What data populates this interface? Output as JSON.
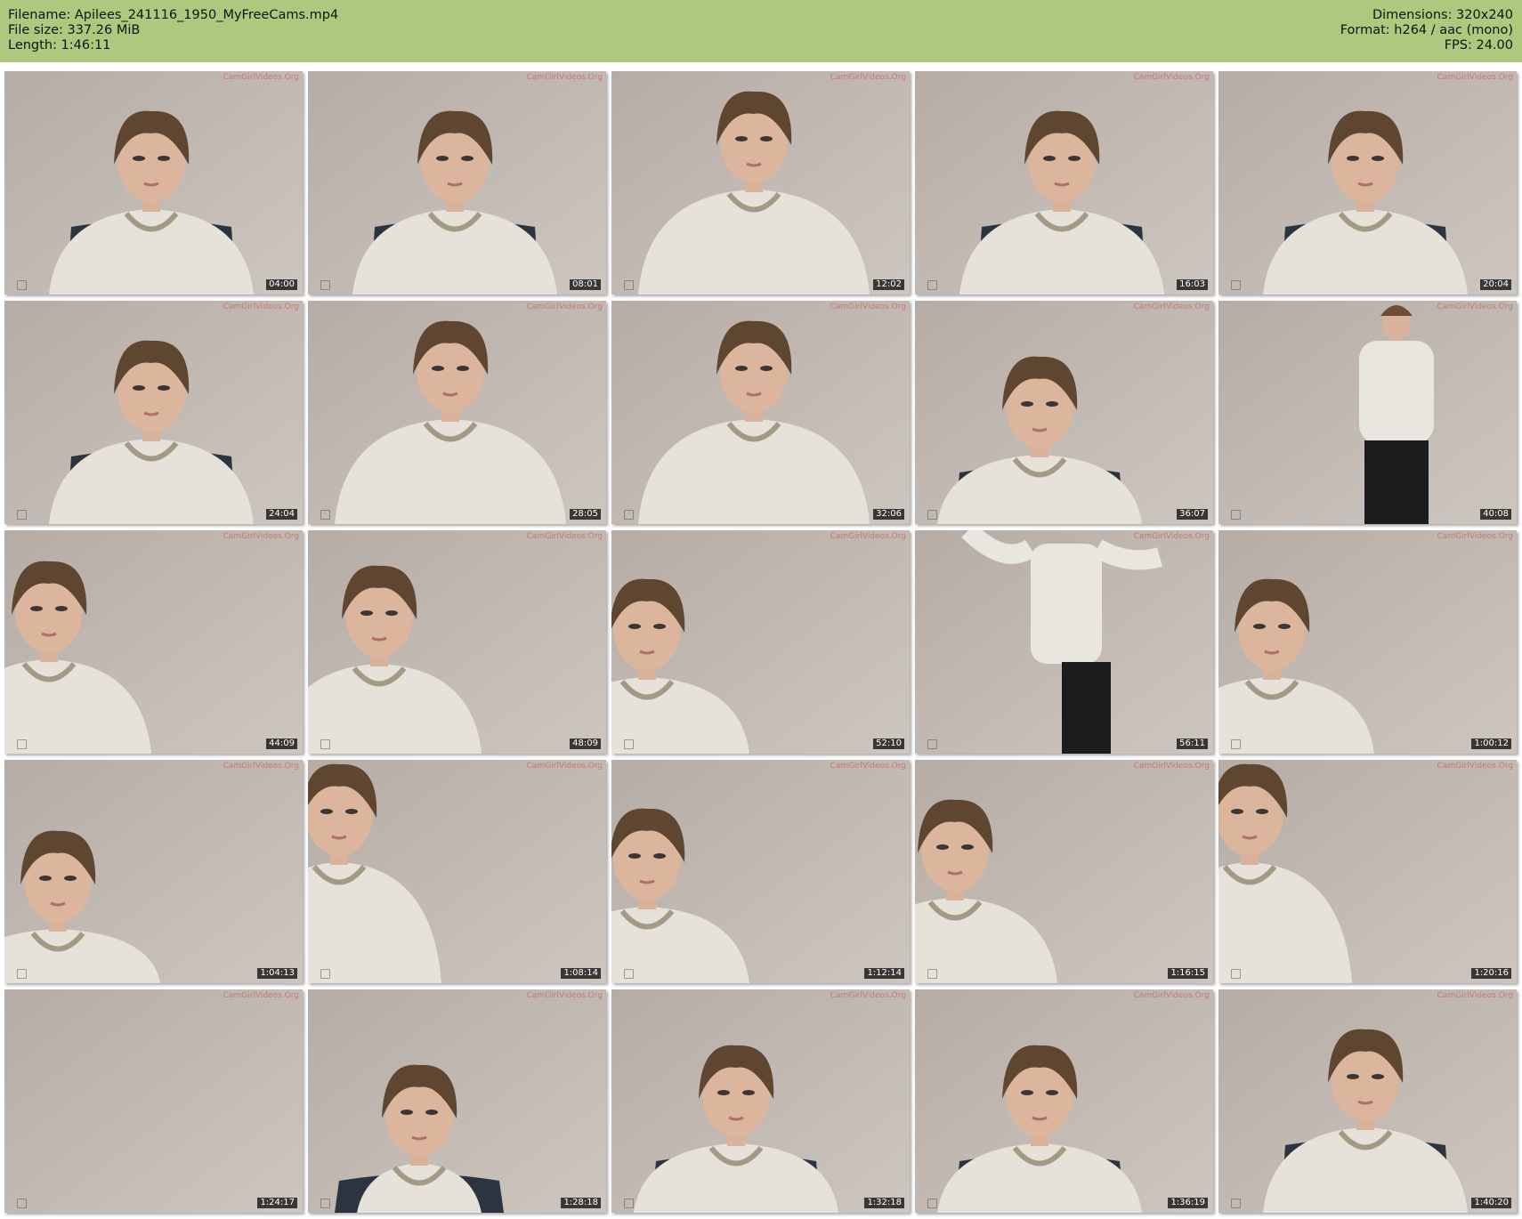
{
  "header": {
    "filename": "Filename: Apilees_241116_1950_MyFreeCams.mp4",
    "filesize": "File size: 337.26 MiB",
    "length": "Length: 1:46:11",
    "dimensions": "Dimensions: 320x240",
    "format": "Format: h264 / aac (mono)",
    "fps": "FPS: 24.00"
  },
  "watermark": "CamGirlVideos.Org",
  "thumbnails": [
    {
      "time": "04:00",
      "scene": "seated-center"
    },
    {
      "time": "08:01",
      "scene": "seated-center"
    },
    {
      "time": "12:02",
      "scene": "seated-close"
    },
    {
      "time": "16:03",
      "scene": "seated-center"
    },
    {
      "time": "20:04",
      "scene": "seated-center"
    },
    {
      "time": "24:04",
      "scene": "seated-center"
    },
    {
      "time": "28:05",
      "scene": "seated-close"
    },
    {
      "time": "32:06",
      "scene": "seated-close"
    },
    {
      "time": "36:07",
      "scene": "seated-low"
    },
    {
      "time": "40:08",
      "scene": "standing"
    },
    {
      "time": "44:09",
      "scene": "left"
    },
    {
      "time": "48:09",
      "scene": "left-center"
    },
    {
      "time": "52:10",
      "scene": "left-low"
    },
    {
      "time": "56:11",
      "scene": "standing-arms"
    },
    {
      "time": "1:00:12",
      "scene": "bent-left"
    },
    {
      "time": "1:04:13",
      "scene": "left-tilt"
    },
    {
      "time": "1:08:14",
      "scene": "left-edge"
    },
    {
      "time": "1:12:14",
      "scene": "left-low"
    },
    {
      "time": "1:16:15",
      "scene": "left-hand"
    },
    {
      "time": "1:20:16",
      "scene": "left-edge"
    },
    {
      "time": "1:24:17",
      "scene": "empty"
    },
    {
      "time": "1:28:18",
      "scene": "seated-far"
    },
    {
      "time": "1:32:18",
      "scene": "seated-low"
    },
    {
      "time": "1:36:19",
      "scene": "seated-low"
    },
    {
      "time": "1:40:20",
      "scene": "seated-center"
    }
  ]
}
